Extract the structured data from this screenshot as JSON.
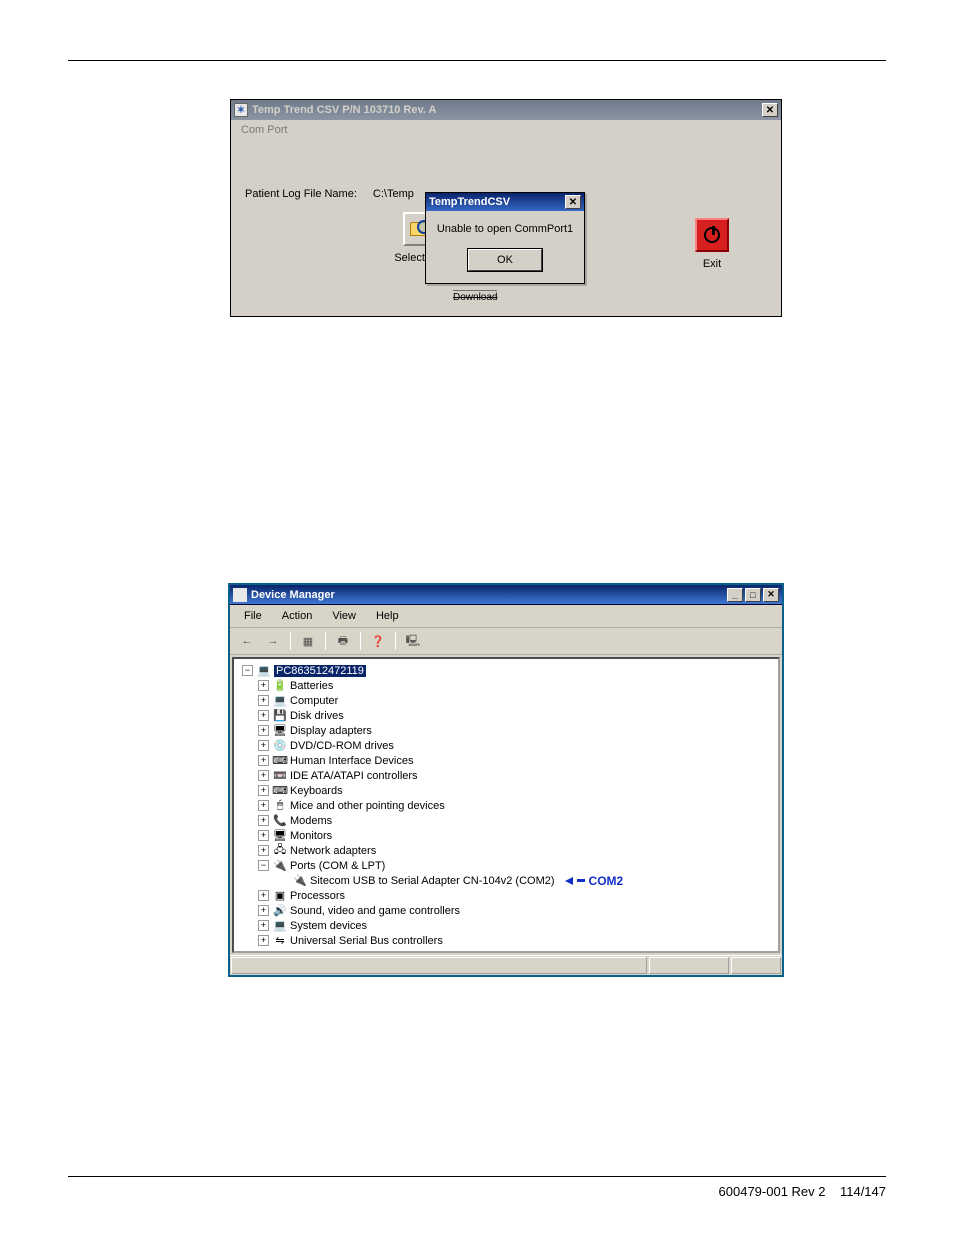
{
  "win1": {
    "title": "Temp Trend CSV    P/N 103710    Rev. A",
    "menu": {
      "com_port": "Com Port"
    },
    "labels": {
      "patient_log": "Patient Log File Name:",
      "path": "C:\\Temp"
    },
    "buttons": {
      "select_file": "Select File",
      "exit": "Exit",
      "download_scrap": "Download"
    }
  },
  "modal": {
    "title": "TempTrendCSV",
    "message": "Unable to open CommPort1",
    "ok": "OK"
  },
  "win2": {
    "title": "Device Manager",
    "menus": {
      "file": "File",
      "action": "Action",
      "view": "View",
      "help": "Help"
    },
    "root": "PC863512472119",
    "nodes": [
      {
        "exp": "+",
        "ico": "🔋",
        "label": "Batteries"
      },
      {
        "exp": "+",
        "ico": "💻",
        "label": "Computer"
      },
      {
        "exp": "+",
        "ico": "💾",
        "label": "Disk drives"
      },
      {
        "exp": "+",
        "ico": "🖥",
        "label": "Display adapters"
      },
      {
        "exp": "+",
        "ico": "💿",
        "label": "DVD/CD-ROM drives"
      },
      {
        "exp": "+",
        "ico": "⌨",
        "label": "Human Interface Devices"
      },
      {
        "exp": "+",
        "ico": "📼",
        "label": "IDE ATA/ATAPI controllers"
      },
      {
        "exp": "+",
        "ico": "⌨",
        "label": "Keyboards"
      },
      {
        "exp": "+",
        "ico": "🖱",
        "label": "Mice and other pointing devices"
      },
      {
        "exp": "+",
        "ico": "📞",
        "label": "Modems"
      },
      {
        "exp": "+",
        "ico": "🖥",
        "label": "Monitors"
      },
      {
        "exp": "+",
        "ico": "🖧",
        "label": "Network adapters"
      }
    ],
    "ports_node": {
      "exp": "−",
      "ico": "🔌",
      "label": "Ports (COM & LPT)"
    },
    "ports_child": {
      "ico": "🔌",
      "label": "Sitecom USB to Serial Adapter CN-104v2 (COM2)"
    },
    "nodes_after": [
      {
        "exp": "+",
        "ico": "▣",
        "label": "Processors"
      },
      {
        "exp": "+",
        "ico": "🔊",
        "label": "Sound, video and game controllers"
      },
      {
        "exp": "+",
        "ico": "💻",
        "label": "System devices"
      },
      {
        "exp": "+",
        "ico": "⇋",
        "label": "Universal Serial Bus controllers"
      }
    ],
    "annotation": "COM2"
  },
  "footer": {
    "left": "600479-001 Rev 2",
    "right": "114/147"
  }
}
